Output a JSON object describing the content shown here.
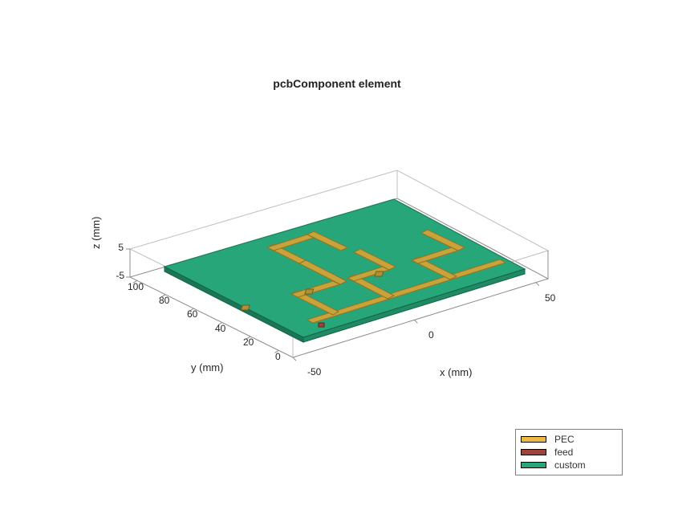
{
  "title": "pcbComponent element",
  "axes": {
    "x": {
      "label": "x (mm)",
      "ticks": [
        "-50",
        "0",
        "50"
      ]
    },
    "y": {
      "label": "y (mm)",
      "ticks": [
        "0",
        "20",
        "40",
        "60",
        "80",
        "100"
      ]
    },
    "z": {
      "label": "z (mm)",
      "ticks": [
        "-5",
        "5"
      ]
    }
  },
  "legend": {
    "items": [
      {
        "label": "PEC",
        "color": "#eeb942"
      },
      {
        "label": "feed",
        "color": "#a0413a"
      },
      {
        "label": "custom",
        "color": "#27a67a"
      }
    ]
  },
  "chart_data": {
    "type": "surface-3d",
    "title": "pcbComponent element",
    "xlabel": "x (mm)",
    "ylabel": "y (mm)",
    "zlabel": "z (mm)",
    "xlim": [
      -50,
      55
    ],
    "ylim": [
      -10,
      105
    ],
    "zlim": [
      -5,
      5
    ],
    "xticks": [
      -50,
      0,
      50
    ],
    "yticks": [
      0,
      20,
      40,
      60,
      80,
      100
    ],
    "zticks": [
      -5,
      5
    ],
    "series": [
      {
        "name": "PEC",
        "color": "#eeb942"
      },
      {
        "name": "feed",
        "color": "#a0413a"
      },
      {
        "name": "custom",
        "color": "#27a67a"
      }
    ],
    "note": "3D PCB component visualization; board sits near z=0, metallic traces (PEC) on top of a custom substrate, feed location marked."
  }
}
